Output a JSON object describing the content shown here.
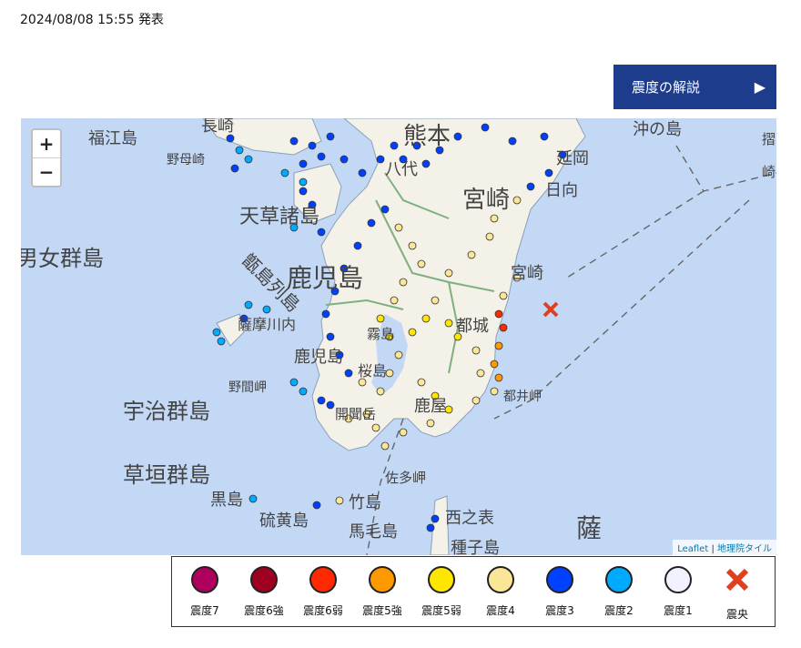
{
  "announcement": "2024/08/08 15:55 発表",
  "explain_button": {
    "label": "震度の解説",
    "icon": "play-arrow-icon"
  },
  "map": {
    "zoom_in": "+",
    "zoom_out": "−",
    "attribution": {
      "leaflet": "Leaflet",
      "separator": "|",
      "tiles": "地理院タイル"
    },
    "place_labels": [
      "長崎",
      "福江島",
      "野母崎",
      "熊本",
      "八代",
      "天草諸島",
      "男女群島",
      "鹿児島",
      "甑島列島",
      "薩摩川内",
      "鹿児島",
      "野間岬",
      "宇治群島",
      "開聞岳",
      "草垣群島",
      "黒島",
      "硫黄島",
      "竹島",
      "佐多岬",
      "馬毛島",
      "西之表",
      "種子島",
      "宮崎",
      "延岡",
      "日向",
      "沖の島",
      "都城",
      "霧島",
      "鹿屋",
      "都井岬",
      "桜島",
      "宮崎",
      "摺",
      "崎",
      "薩"
    ]
  },
  "legend": [
    {
      "label": "震度7",
      "color": "#b0005e"
    },
    {
      "label": "震度6強",
      "color": "#a00020"
    },
    {
      "label": "震度6弱",
      "color": "#ff2800"
    },
    {
      "label": "震度5強",
      "color": "#ff9900"
    },
    {
      "label": "震度5弱",
      "color": "#ffe600"
    },
    {
      "label": "震度4",
      "color": "#fae696"
    },
    {
      "label": "震度3",
      "color": "#0041ff"
    },
    {
      "label": "震度2",
      "color": "#00aaff"
    },
    {
      "label": "震度1",
      "color": "#f2f2ff"
    },
    {
      "label": "震央",
      "color": "#e0401f"
    }
  ]
}
